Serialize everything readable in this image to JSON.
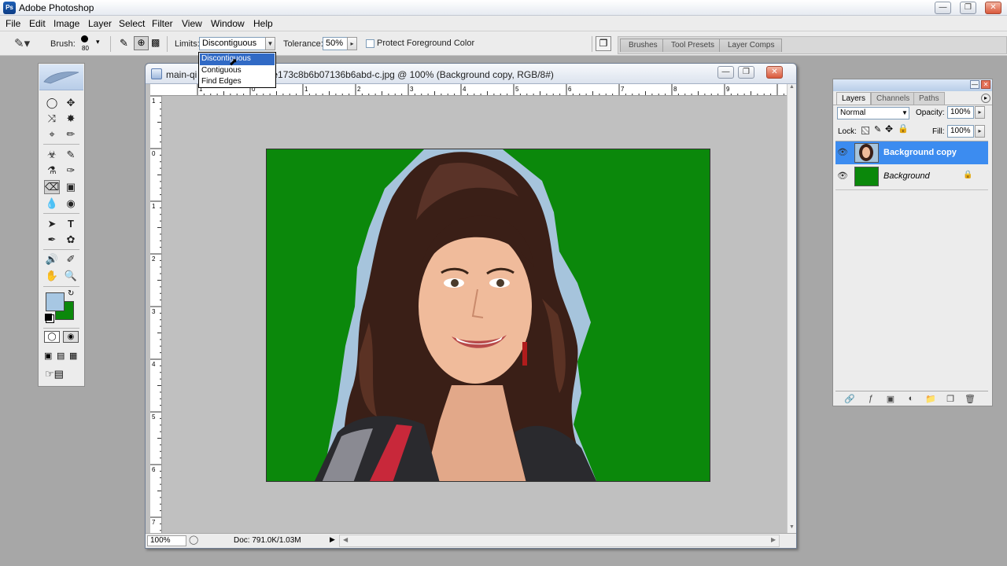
{
  "app": {
    "title": "Adobe Photoshop",
    "logo_text": "Ps"
  },
  "menu": [
    "File",
    "Edit",
    "Image",
    "Layer",
    "Select",
    "Filter",
    "View",
    "Window",
    "Help"
  ],
  "options": {
    "brush_label": "Brush:",
    "brush_size": "80",
    "limits_label": "Limits:",
    "limits_value": "Discontiguous",
    "tolerance_label": "Tolerance:",
    "tolerance_value": "50%",
    "protect_label": "Protect Foreground Color",
    "protect_checked": false
  },
  "limits_dropdown": {
    "options": [
      "Discontiguous",
      "Contiguous",
      "Find Edges"
    ],
    "selected_index": 0
  },
  "palette_well": {
    "tabs": [
      "Brushes",
      "Tool Presets",
      "Layer Comps"
    ]
  },
  "document": {
    "title": "main-qimg-e173c8b6b07136b6abd-c.jpg @ 100% (Background copy, RGB/8#)",
    "title_visible_left": "main-qi",
    "title_visible_right": "e173c8b6b07136b6abd-c.jpg @ 100% (Background copy, RGB/8#)",
    "zoom": "100%",
    "doc_size": "Doc: 791.0K/1.03M",
    "ruler_top": [
      "1",
      "0",
      "1",
      "2",
      "3",
      "4",
      "5",
      "6",
      "7",
      "8",
      "9"
    ],
    "ruler_left": [
      "1",
      "0",
      "1",
      "2",
      "3",
      "4",
      "5",
      "6",
      "7"
    ]
  },
  "colors": {
    "foreground": "#a7c7e3",
    "background": "#0b880b",
    "selection": "#316ac5"
  },
  "layers_palette": {
    "tabs": [
      "Layers",
      "Channels",
      "Paths"
    ],
    "blend_mode": "Normal",
    "opacity_label": "Opacity:",
    "opacity_value": "100%",
    "lock_label": "Lock:",
    "fill_label": "Fill:",
    "fill_value": "100%",
    "layers": [
      {
        "name": "Background copy",
        "selected": true,
        "visible": true,
        "locked": false
      },
      {
        "name": "Background",
        "selected": false,
        "visible": true,
        "locked": true
      }
    ]
  }
}
